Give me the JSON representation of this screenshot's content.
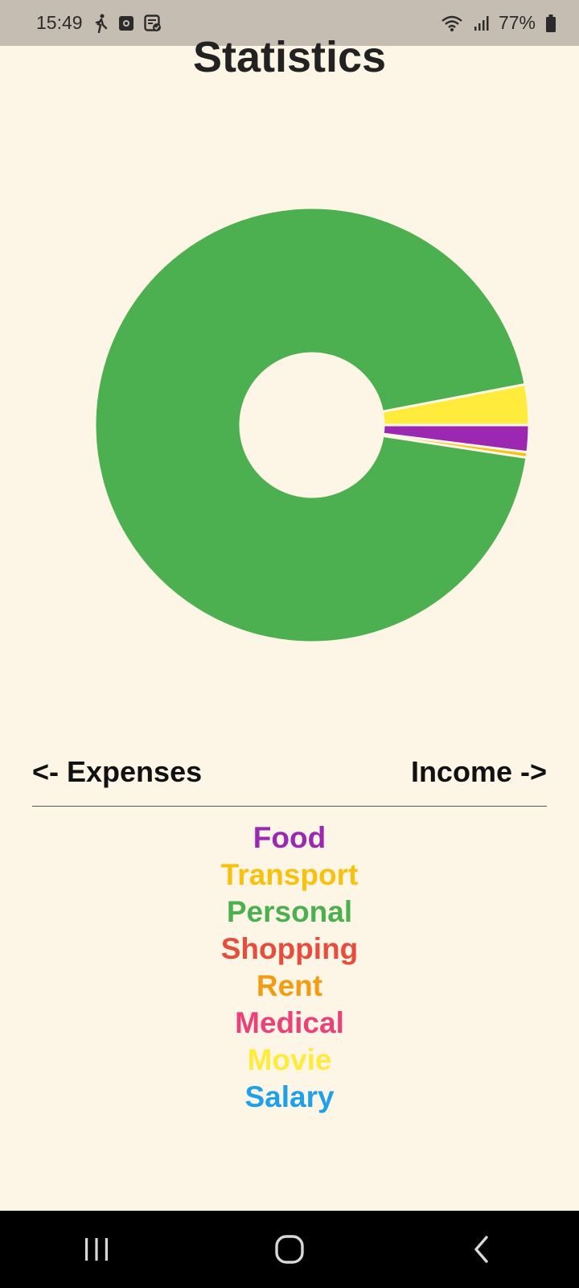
{
  "status_bar": {
    "time": "15:49",
    "battery": "77%",
    "icons": [
      "walking-icon",
      "camera-app-icon",
      "task-check-icon",
      "wifi-icon",
      "signal-icon",
      "battery-icon"
    ]
  },
  "title": "Statistics",
  "navigation": {
    "prev_label": "<- Expenses",
    "next_label": "Income ->"
  },
  "chart_data": {
    "type": "pie",
    "style": "donut",
    "slices": [
      {
        "label": "Movie",
        "value": 3.0,
        "color": "#ffeb3b"
      },
      {
        "label": "Food",
        "value": 2.0,
        "color": "#9c27b0"
      },
      {
        "label": "Transport",
        "value": 0.4,
        "color": "#f9c10d"
      },
      {
        "label": "Personal",
        "value": 94.6,
        "color": "#4caf50"
      }
    ]
  },
  "legend": [
    {
      "label": "Food",
      "color": "#9c27b0"
    },
    {
      "label": "Transport",
      "color": "#f9c10d"
    },
    {
      "label": "Personal",
      "color": "#4caf50"
    },
    {
      "label": "Shopping",
      "color": "#e74c3c"
    },
    {
      "label": "Rent",
      "color": "#f39c12"
    },
    {
      "label": "Medical",
      "color": "#ec407a"
    },
    {
      "label": "Movie",
      "color": "#ffeb3b"
    },
    {
      "label": "Salary",
      "color": "#1ea1e8"
    }
  ],
  "system_nav": [
    "recents-icon",
    "home-icon",
    "back-icon"
  ]
}
